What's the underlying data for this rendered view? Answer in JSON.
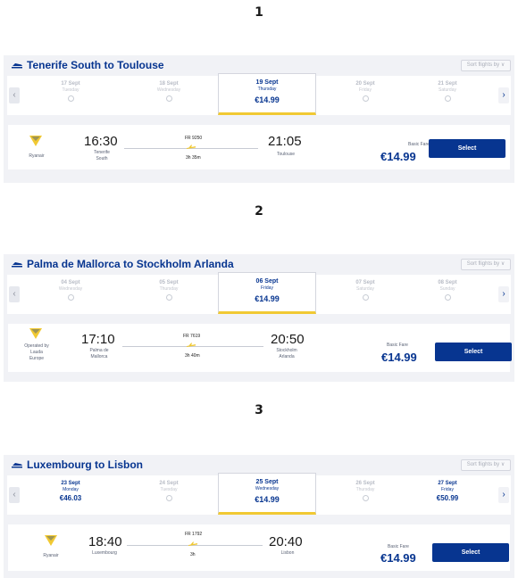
{
  "sections": [
    {
      "number": "1",
      "route": "Tenerife South to Toulouse",
      "sort_label": "Sort flights by",
      "dates": [
        {
          "day": "17 Sept",
          "weekday": "Tuesday",
          "price": ""
        },
        {
          "day": "18 Sept",
          "weekday": "Wednesday",
          "price": ""
        },
        {
          "day": "19 Sept",
          "weekday": "Thursday",
          "price": "€14.99"
        },
        {
          "day": "20 Sept",
          "weekday": "Friday",
          "price": ""
        },
        {
          "day": "21 Sept",
          "weekday": "Saturday",
          "price": ""
        }
      ],
      "flight": {
        "operator": [
          "Ryanair"
        ],
        "depart_time": "16:30",
        "depart_place": [
          "Tenerife",
          "South"
        ],
        "flight_number": "FR 9250",
        "duration": "3h 35m",
        "arrive_time": "21:05",
        "arrive_place": [
          "Toulouse"
        ],
        "fare_label": "Basic Fare",
        "price": "€14.99",
        "select_label": "Select"
      }
    },
    {
      "number": "2",
      "route": "Palma de Mallorca to Stockholm Arlanda",
      "sort_label": "Sort flights by",
      "dates": [
        {
          "day": "04 Sept",
          "weekday": "Wednesday",
          "price": ""
        },
        {
          "day": "05 Sept",
          "weekday": "Thursday",
          "price": ""
        },
        {
          "day": "06 Sept",
          "weekday": "Friday",
          "price": "€14.99"
        },
        {
          "day": "07 Sept",
          "weekday": "Saturday",
          "price": ""
        },
        {
          "day": "08 Sept",
          "weekday": "Sunday",
          "price": ""
        }
      ],
      "flight": {
        "operator": [
          "Operated by",
          "Lauda",
          "Europe"
        ],
        "depart_time": "17:10",
        "depart_place": [
          "Palma de",
          "Mallorca"
        ],
        "flight_number": "FR 7619",
        "duration": "3h 40m",
        "arrive_time": "20:50",
        "arrive_place": [
          "Stockholm",
          "Arlanda"
        ],
        "fare_label": "Basic Fare",
        "price": "€14.99",
        "select_label": "Select"
      }
    },
    {
      "number": "3",
      "route": "Luxembourg to Lisbon",
      "sort_label": "Sort flights by",
      "dates": [
        {
          "day": "23 Sept",
          "weekday": "Monday",
          "price": "€46.03"
        },
        {
          "day": "24 Sept",
          "weekday": "Tuesday",
          "price": ""
        },
        {
          "day": "25 Sept",
          "weekday": "Wednesday",
          "price": "€14.99"
        },
        {
          "day": "26 Sept",
          "weekday": "Thursday",
          "price": ""
        },
        {
          "day": "27 Sept",
          "weekday": "Friday",
          "price": "€50.99"
        }
      ],
      "flight": {
        "operator": [
          "Ryanair"
        ],
        "depart_time": "18:40",
        "depart_place": [
          "Luxembourg"
        ],
        "flight_number": "FR 1792",
        "duration": "3h",
        "arrive_time": "20:40",
        "arrive_place": [
          "Lisbon"
        ],
        "fare_label": "Basic Fare",
        "price": "€14.99",
        "select_label": "Select"
      }
    }
  ],
  "colors": {
    "brand_blue": "#073590",
    "accent_yellow": "#f1c933",
    "panel_bg": "#f1f2f6"
  }
}
